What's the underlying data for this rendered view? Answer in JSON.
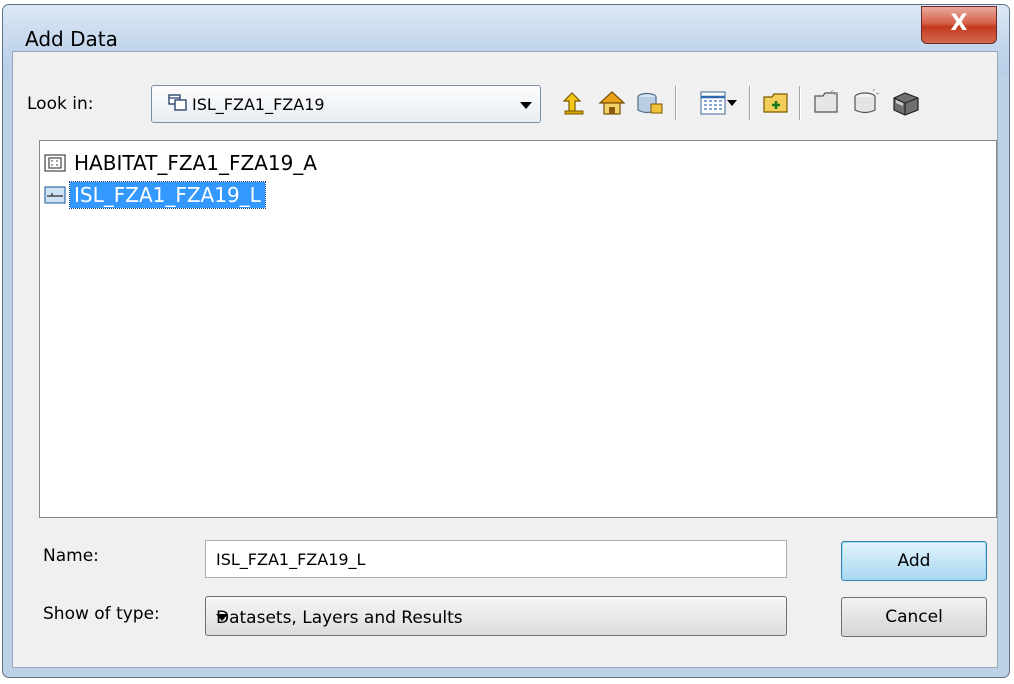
{
  "window": {
    "title": "Add Data",
    "close_label": "X"
  },
  "look_in": {
    "label": "Look in:",
    "value": "ISL_FZA1_FZA19"
  },
  "toolbar": {
    "icons": [
      "up-one-level-icon",
      "home-icon",
      "connect-folder-icon",
      "view-options-icon",
      "new-folder-icon",
      "new-file-geodatabase-icon",
      "new-personal-geodatabase-icon",
      "new-database-connection-icon"
    ]
  },
  "files": [
    {
      "name": "HABITAT_FZA1_FZA19_A",
      "icon": "polygon-feature-class-icon",
      "selected": false
    },
    {
      "name": "ISL_FZA1_FZA19_L",
      "icon": "line-feature-class-icon",
      "selected": true
    }
  ],
  "name_field": {
    "label": "Name:",
    "value": "ISL_FZA1_FZA19_L"
  },
  "type_field": {
    "label": "Show of type:",
    "value": "Datasets, Layers and Results"
  },
  "buttons": {
    "add": "Add",
    "cancel": "Cancel"
  },
  "colors": {
    "selection": "#3399ff",
    "close": "#c7432a"
  }
}
